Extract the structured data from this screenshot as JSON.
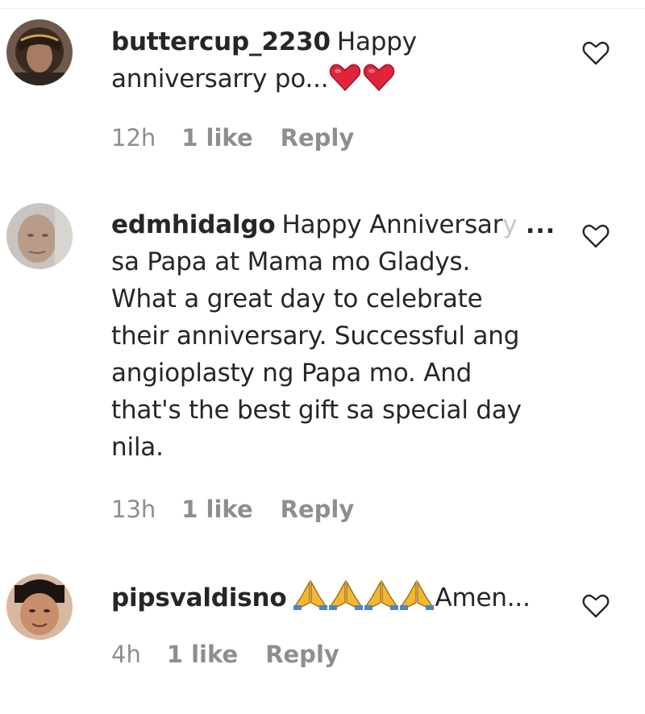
{
  "comments": [
    {
      "username": "buttercup_2230",
      "text_before": "Happy anniversarry po...",
      "emoji": "heart-emoji x2",
      "time": "12h",
      "likes": "1 like",
      "reply": "Reply",
      "avatar_icon": "user-avatar"
    },
    {
      "username": "edmhidalgo",
      "text_first": "Happy Anniversar",
      "text_faded": "y",
      "more": "...",
      "text_rest": "sa Papa at Mama mo Gladys. What a great day to celebrate their anniversary. Successful ang angioplasty ng Papa mo. And that's the best gift sa special day nila.",
      "time": "13h",
      "likes": "1 like",
      "reply": "Reply",
      "avatar_icon": "user-avatar"
    },
    {
      "username": "pipsvaldisno",
      "text_after": "Amen...",
      "emoji": "folded-hands-emoji x4",
      "time": "4h",
      "likes": "1 like",
      "reply": "Reply",
      "avatar_icon": "user-avatar"
    }
  ],
  "colors": {
    "text": "#262626",
    "secondary": "#8e8e8e",
    "heart_emoji": "#e0243b",
    "hands_emoji": "#f5b730"
  },
  "icons": {
    "like": "heart-outline-icon"
  }
}
